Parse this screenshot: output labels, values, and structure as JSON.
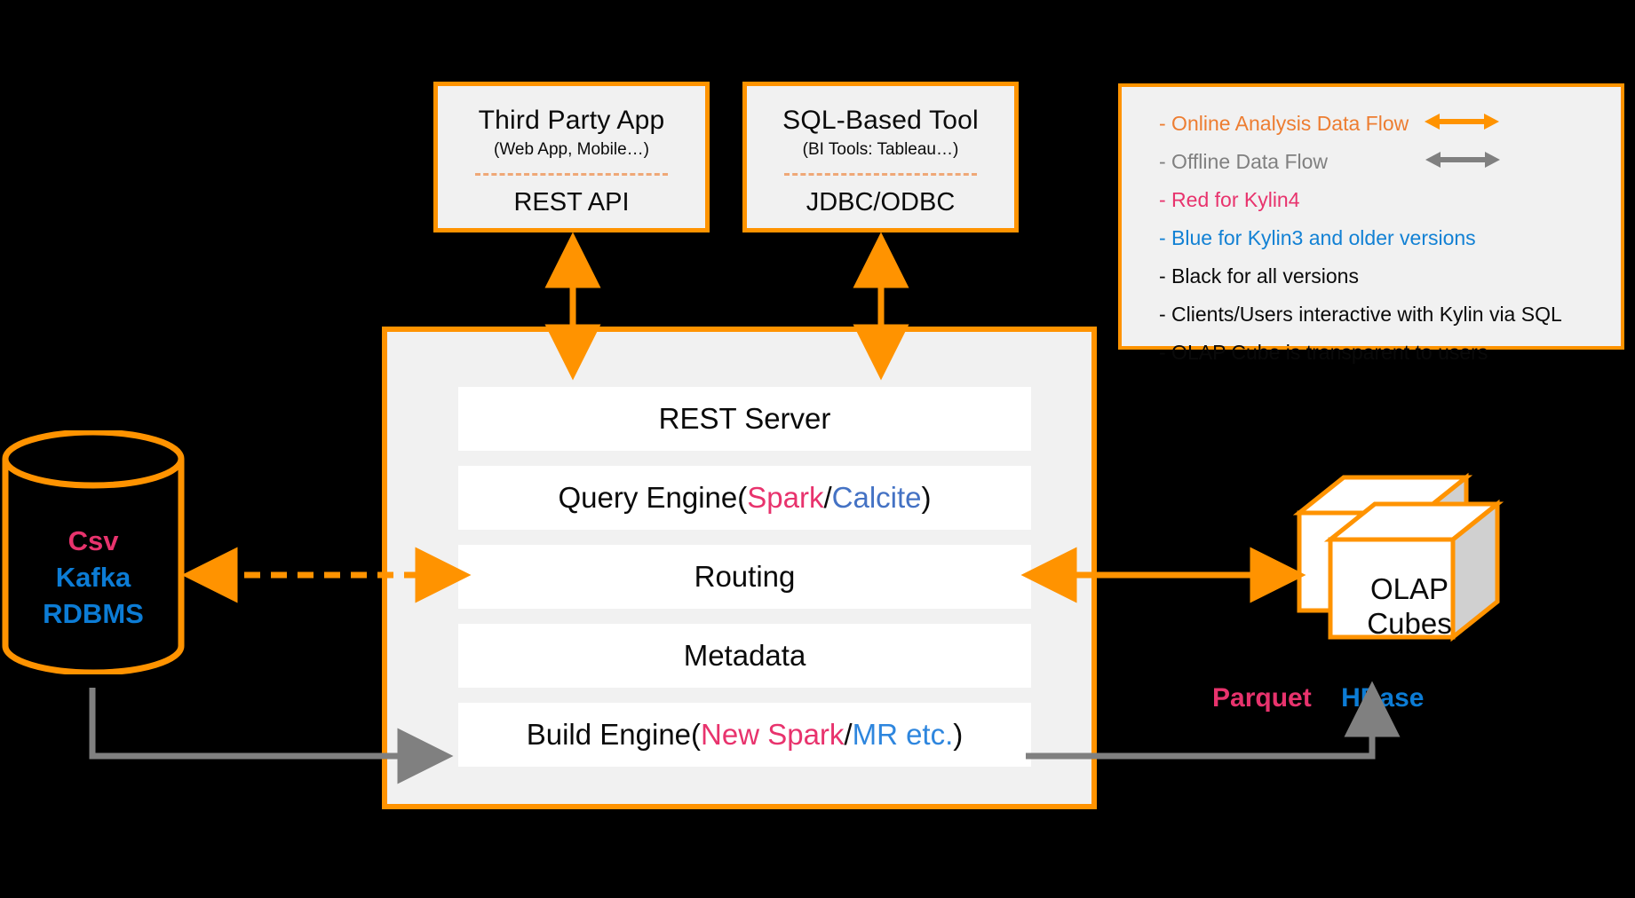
{
  "clients": [
    {
      "id": "third-party-app",
      "title": "Third Party App",
      "subtitle": "(Web App, Mobile…)",
      "api": "REST API"
    },
    {
      "id": "sql-based-tool",
      "title": "SQL-Based Tool",
      "subtitle": "(BI Tools: Tableau…)",
      "api": "JDBC/ODBC"
    }
  ],
  "kylin": {
    "layers": [
      {
        "id": "rest-server",
        "parts": [
          {
            "text": "REST Server",
            "color": "black"
          }
        ]
      },
      {
        "id": "query-engine",
        "parts": [
          {
            "text": "Query Engine(",
            "color": "black"
          },
          {
            "text": "Spark",
            "color": "pink"
          },
          {
            "text": "/",
            "color": "black"
          },
          {
            "text": "Calcite",
            "color": "blue-calcite"
          },
          {
            "text": ")",
            "color": "black"
          }
        ]
      },
      {
        "id": "routing",
        "parts": [
          {
            "text": "Routing",
            "color": "black"
          }
        ]
      },
      {
        "id": "metadata",
        "parts": [
          {
            "text": "Metadata",
            "color": "black"
          }
        ]
      },
      {
        "id": "build-engine",
        "parts": [
          {
            "text": "Build Engine(",
            "color": "black"
          },
          {
            "text": "New Spark",
            "color": "pink"
          },
          {
            "text": "/",
            "color": "black"
          },
          {
            "text": "MR etc.",
            "color": "blue-mr"
          },
          {
            "text": ")",
            "color": "black"
          }
        ]
      }
    ]
  },
  "legend": {
    "items": [
      {
        "id": "online-analysis-data-flow",
        "label": "- Online Analysis Data Flow",
        "color": "orange",
        "arrow": "orange-double-arrow"
      },
      {
        "id": "offline-data-flow",
        "label": "- Offline Data Flow",
        "color": "gray",
        "arrow": "gray-double-arrow"
      },
      {
        "id": "red-for-kylin4",
        "label": "- Red for Kylin4",
        "color": "pink",
        "arrow": ""
      },
      {
        "id": "blue-for-kylin3",
        "label": "- Blue for Kylin3 and older versions",
        "color": "blue",
        "arrow": ""
      },
      {
        "id": "black-for-all-versions",
        "label": "- Black for all versions",
        "color": "black",
        "arrow": ""
      },
      {
        "id": "clients-users-sql",
        "label": "- Clients/Users interactive with Kylin via SQL",
        "color": "black",
        "arrow": ""
      },
      {
        "id": "olap-cube-transparent",
        "label": "- OLAP Cube is transparent to users",
        "color": "black",
        "arrow": ""
      }
    ]
  },
  "source": {
    "lines": [
      {
        "text": "Csv",
        "color": "pink"
      },
      {
        "text": "Kafka",
        "color": "blue"
      },
      {
        "text": "RDBMS",
        "color": "blue"
      }
    ]
  },
  "storage": {
    "cube_label_line1": "OLAP",
    "cube_label_line2": "Cubes",
    "parquet": "Parquet",
    "hbase": "HBase"
  },
  "colors": {
    "orange_border": "#FF9300",
    "orange_legend_text": "#ED7D31",
    "gray_flow": "#808080",
    "pink": "#E8336D",
    "blue_calcite": "#4472C4",
    "blue_bright": "#0C7CD5",
    "panel_fill": "#F1F1F1",
    "layer_fill": "#FFFFFF",
    "background": "#000000"
  }
}
